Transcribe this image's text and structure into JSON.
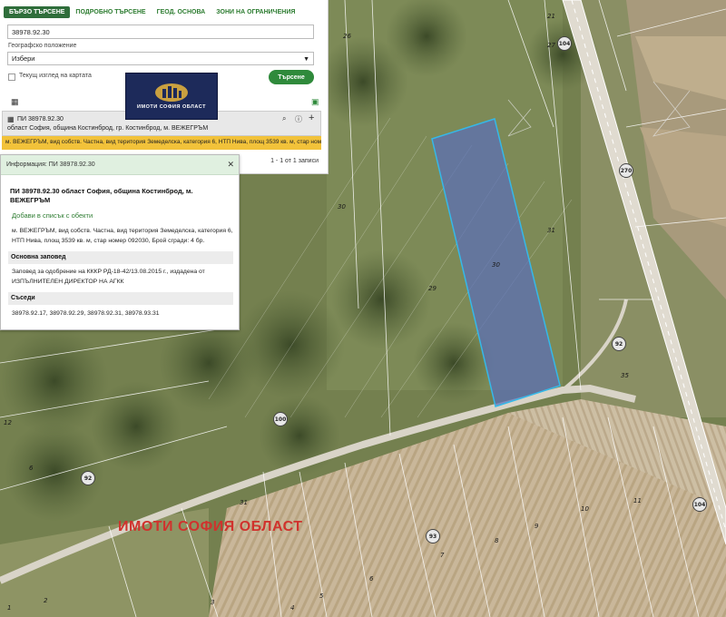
{
  "tabs": [
    "БЪРЗО ТЪРСЕНЕ",
    "ПОДРОБНО ТЪРСЕНЕ",
    "ГЕОД. ОСНОВА",
    "ЗОНИ НА ОГРАНИЧЕНИЯ"
  ],
  "search": {
    "query": "38978.92.30",
    "geo_label": "Географско положение",
    "geo_value": "Избери",
    "checkbox_label": "Текущ изглед на картата",
    "button_label": "Търсене"
  },
  "result": {
    "id": "ПИ 38978.92.30",
    "location": "област София, община Костинброд, гр. Костинброд, м. ВЕЖЕГРЪМ",
    "summary": "м. ВЕЖЕГРЪМ, вид собств. Частна, вид територия Земеделска, категория 6, НТП Нива, площ 3539 кв. м, стар номер 092030",
    "count": "1 - 1 от 1 записи"
  },
  "logo": {
    "text": "ИМОТИ СОФИЯ ОБЛАСТ"
  },
  "info": {
    "header": "Информация: ПИ 38978.92.30",
    "title": "ПИ 38978.92.30 област София, община Костинброд, м. ВЕЖЕГРЪМ",
    "add_link": "Добави в списък с обекти",
    "description": "м. ВЕЖЕГРЪМ, вид собств. Частна, вид територия Земеделска, категория 6, НТП Нива, площ 3539 кв. м, стар номер 092030, Брой сгради: 4 бр.",
    "order_heading": "Основна заповед",
    "order_text": "Заповед за одобрение на КККР РД-18-42/13.08.2015 г., издадена от ИЗПЪЛНИТЕЛЕН ДИРЕКТОР НА АГКК",
    "neighbors_heading": "Съседи",
    "neighbors": "38978.92.17, 38978.92.29, 38978.92.31, 38978.93.31"
  },
  "map": {
    "watermark": "ИМОТИ СОФИЯ ОБЛАСТ",
    "parcel_labels": [
      "26",
      "27",
      "21",
      "31",
      "30",
      "29",
      "35",
      "30",
      "12",
      "6",
      "31",
      "10",
      "11",
      "9",
      "8",
      "7",
      "6",
      "5",
      "4",
      "3",
      "2",
      "1"
    ],
    "road_badges": [
      "104",
      "270",
      "92",
      "100",
      "92",
      "93",
      "104"
    ],
    "colors": {
      "parcel_fill": "#5a6fb8",
      "parcel_stroke": "#35b8e8",
      "road": "#d9d4c8",
      "highlight": "#f2c23a",
      "accent": "#2f8a3b"
    }
  }
}
